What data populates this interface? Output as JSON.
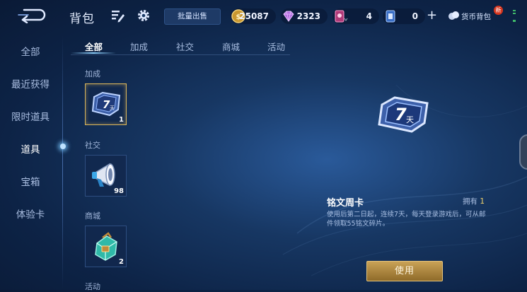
{
  "header": {
    "title": "背包",
    "bulk_sell_label": "批量出售",
    "currencies": [
      {
        "icon": "gold-coin-icon",
        "value": "25087"
      },
      {
        "icon": "diamond-icon",
        "value": "2323"
      },
      {
        "icon": "voucher-icon",
        "value": "4"
      },
      {
        "icon": "ticket-icon",
        "value": "0"
      }
    ],
    "plus_label": "+",
    "currency_bag_label": "货币背包",
    "new_badge": "新"
  },
  "sidebar": {
    "items": [
      {
        "label": "全部",
        "active": false
      },
      {
        "label": "最近获得",
        "active": false
      },
      {
        "label": "限时道具",
        "active": false
      },
      {
        "label": "道具",
        "active": true
      },
      {
        "label": "宝箱",
        "active": false
      },
      {
        "label": "体验卡",
        "active": false
      }
    ]
  },
  "tabs": [
    {
      "label": "全部",
      "active": true
    },
    {
      "label": "加成",
      "active": false
    },
    {
      "label": "社交",
      "active": false
    },
    {
      "label": "商城",
      "active": false
    },
    {
      "label": "活动",
      "active": false
    }
  ],
  "sections": [
    {
      "label": "加成",
      "items": [
        {
          "icon": "rune-week-card-icon",
          "count": "1",
          "selected": true,
          "badge": "7",
          "badge_unit": "天"
        }
      ]
    },
    {
      "label": "社交",
      "items": [
        {
          "icon": "megaphone-icon",
          "count": "98",
          "selected": false
        }
      ]
    },
    {
      "label": "商城",
      "items": [
        {
          "icon": "treasure-chest-icon",
          "count": "2",
          "selected": false
        }
      ]
    },
    {
      "label": "活动",
      "items": []
    }
  ],
  "detail": {
    "name": "铭文周卡",
    "owned_label": "拥有",
    "owned_count": "1",
    "description": "使用后第二日起，连续7天，每天登录游戏后，可从邮件领取55铭文碎片。",
    "use_label": "使用",
    "badge": "7",
    "badge_unit": "天"
  },
  "colors": {
    "accent_gold": "#d9b45a",
    "owned_count": "#f2d36b",
    "active_glow": "#8fd2ff"
  }
}
